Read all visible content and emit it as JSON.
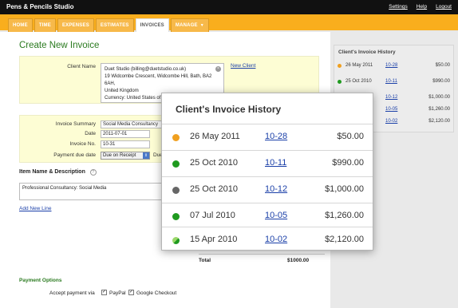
{
  "app": {
    "brand": "Pens & Pencils Studio",
    "links": [
      "Settings",
      "Help",
      "Logout"
    ]
  },
  "nav": {
    "tabs": [
      "HOME",
      "TIME",
      "EXPENSES",
      "ESTIMATES",
      "INVOICES",
      "MANAGE"
    ],
    "active": "INVOICES"
  },
  "page": {
    "title": "Create New Invoice"
  },
  "client": {
    "label": "Client Name",
    "name": "Duet Studio (billing@duetstudio.co.uk)",
    "address_line1": "19 Widcombe Crescent, Widcombe Hill, Bath, BA2 6AH,",
    "address_line2": "United Kingdom",
    "currency": "Currency: United States of A",
    "new_client_link": "New Client"
  },
  "summary": {
    "summary_label": "Invoice Summary",
    "summary_value": "Social Media Consultancy",
    "date_label": "Date",
    "date_value": "2011-07-01",
    "number_label": "Invoice No.",
    "number_value": "10-31",
    "due_label": "Payment due date",
    "due_value": "Due on Receipt",
    "due_trailing": "Due"
  },
  "items": {
    "heading": "Item Name & Description",
    "help": "?",
    "first_item": "Professional Consultancy: Social Media",
    "add_line": "Add New Line"
  },
  "totals": {
    "label": "Total",
    "value": "$1000.00"
  },
  "payment": {
    "heading": "Payment Options",
    "accept_label": "Accept payment via",
    "options": [
      {
        "label": "PayPal",
        "checked": true
      },
      {
        "label": "Google Checkout",
        "checked": true
      }
    ]
  },
  "sidebar_history": {
    "title": "Client's Invoice History",
    "rows": [
      {
        "date": "26 May 2011",
        "number": "10-28",
        "amount": "$50.00",
        "color": "#f0a020"
      },
      {
        "date": "25 Oct 2010",
        "number": "10-11",
        "amount": "$990.00",
        "color": "#1f9a1f"
      },
      {
        "date": "",
        "number": "10-12",
        "amount": "$1,000.00",
        "color": "#666666"
      },
      {
        "date": "",
        "number": "10-05",
        "amount": "$1,260.00",
        "color": "#1f9a1f"
      },
      {
        "date": "",
        "number": "10-02",
        "amount": "$2,120.00",
        "color": "#1f9a1f"
      }
    ]
  },
  "popup_history": {
    "title": "Client's Invoice History",
    "rows": [
      {
        "date": "26 May 2011",
        "number": "10-28",
        "amount": "$50.00",
        "color": "#f0a020"
      },
      {
        "date": "25 Oct 2010",
        "number": "10-11",
        "amount": "$990.00",
        "color": "#1f9a1f"
      },
      {
        "date": "25 Oct 2010",
        "number": "10-12",
        "amount": "$1,000.00",
        "color": "#666666"
      },
      {
        "date": "07 Jul 2010",
        "number": "10-05",
        "amount": "$1,260.00",
        "color": "#1f9a1f"
      },
      {
        "date": "15 Apr 2010",
        "number": "10-02",
        "amount": "$2,120.00",
        "color": "#1f9a1f"
      }
    ]
  }
}
